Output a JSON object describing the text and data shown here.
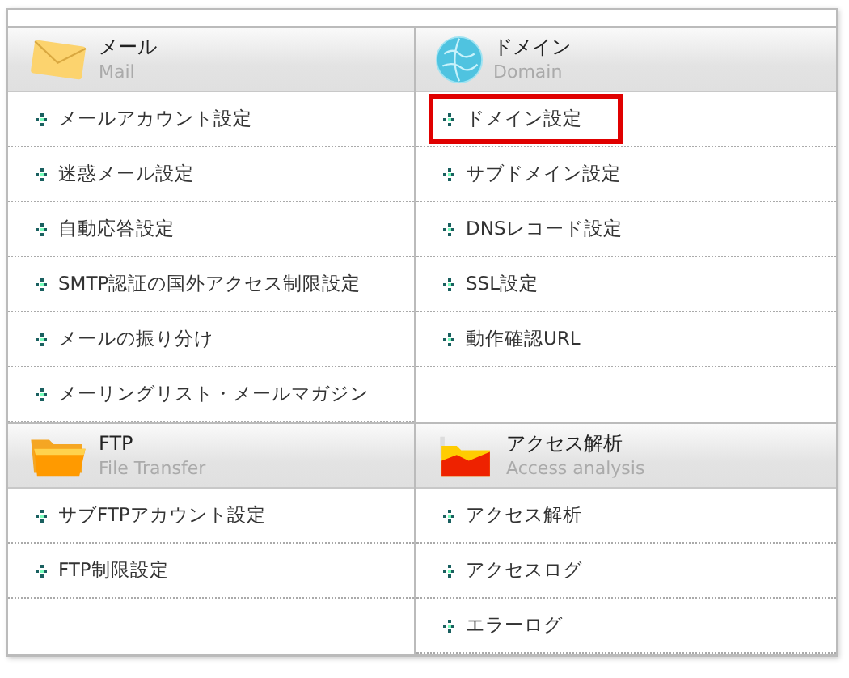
{
  "sections": [
    {
      "kind": "mail",
      "title": "メール",
      "subtitle": "Mail",
      "items": [
        {
          "label": "メールアカウント設定",
          "highlighted": false
        },
        {
          "label": "迷惑メール設定",
          "highlighted": false
        },
        {
          "label": "自動応答設定",
          "highlighted": false
        },
        {
          "label": "SMTP認証の国外アクセス制限設定",
          "highlighted": false
        },
        {
          "label": "メールの振り分け",
          "highlighted": false
        },
        {
          "label": "メーリングリスト・メールマガジン",
          "highlighted": false
        }
      ]
    },
    {
      "kind": "domain",
      "title": "ドメイン",
      "subtitle": "Domain",
      "items": [
        {
          "label": "ドメイン設定",
          "highlighted": true
        },
        {
          "label": "サブドメイン設定",
          "highlighted": false
        },
        {
          "label": "DNSレコード設定",
          "highlighted": false
        },
        {
          "label": "SSL設定",
          "highlighted": false
        },
        {
          "label": "動作確認URL",
          "highlighted": false
        }
      ]
    },
    {
      "kind": "ftp",
      "title": "FTP",
      "subtitle": "File Transfer",
      "items": [
        {
          "label": "サブFTPアカウント設定",
          "highlighted": false
        },
        {
          "label": "FTP制限設定",
          "highlighted": false
        }
      ]
    },
    {
      "kind": "access",
      "title": "アクセス解析",
      "subtitle": "Access analysis",
      "items": [
        {
          "label": "アクセス解析",
          "highlighted": false
        },
        {
          "label": "アクセスログ",
          "highlighted": false
        },
        {
          "label": "エラーログ",
          "highlighted": false
        }
      ]
    }
  ]
}
